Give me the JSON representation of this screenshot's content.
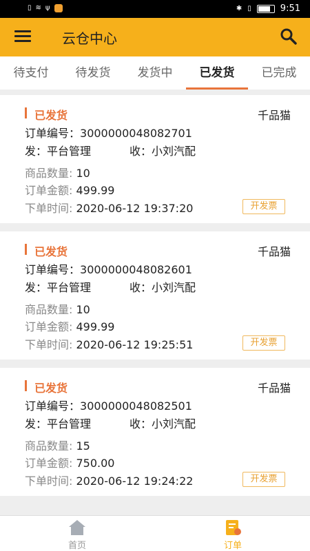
{
  "status_bar": {
    "time": "9:51"
  },
  "header": {
    "title": "云仓中心"
  },
  "tabs": [
    {
      "label": "待支付"
    },
    {
      "label": "待发货"
    },
    {
      "label": "发货中"
    },
    {
      "label": "已发货"
    },
    {
      "label": "已完成"
    }
  ],
  "labels": {
    "order_no": "订单编号：",
    "from": "发：",
    "to": "收：",
    "qty": "商品数量:",
    "amount": "订单金额:",
    "time": "下单时间:",
    "invoice": "开发票"
  },
  "orders": [
    {
      "status": "已发货",
      "shop": "千品猫",
      "order_no": "3000000048082701",
      "sender": "平台管理",
      "receiver": "小刘汽配",
      "qty": "10",
      "amount": "499.99",
      "time": "2020-06-12 19:37:20"
    },
    {
      "status": "已发货",
      "shop": "千品猫",
      "order_no": "3000000048082601",
      "sender": "平台管理",
      "receiver": "小刘汽配",
      "qty": "10",
      "amount": "499.99",
      "time": "2020-06-12 19:25:51"
    },
    {
      "status": "已发货",
      "shop": "千品猫",
      "order_no": "3000000048082501",
      "sender": "平台管理",
      "receiver": "小刘汽配",
      "qty": "15",
      "amount": "750.00",
      "time": "2020-06-12 19:24:22"
    }
  ],
  "bottom_nav": [
    {
      "label": "首页",
      "icon": "home-icon",
      "color": "#999999"
    },
    {
      "label": "订单",
      "icon": "order-icon",
      "color": "#f6b01b"
    }
  ],
  "colors": {
    "accent": "#f6b01b",
    "status": "#e8743a"
  }
}
